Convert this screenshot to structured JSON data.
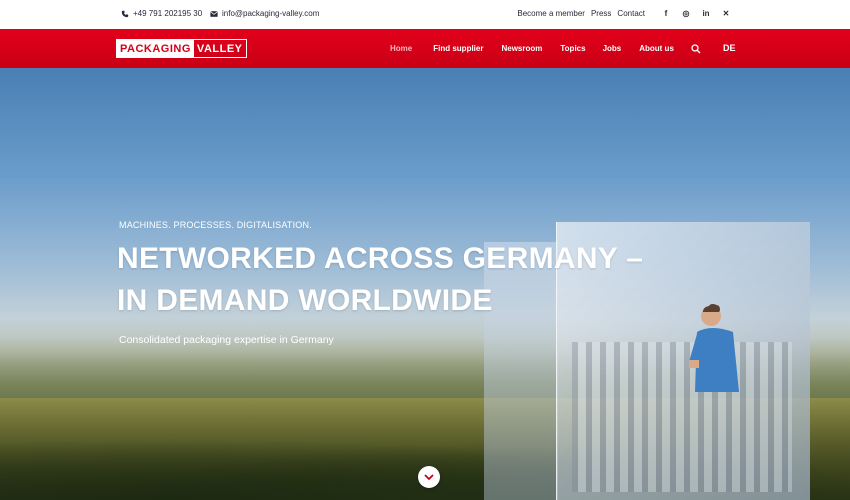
{
  "topbar": {
    "phone": "+49 791 202195 30",
    "email": "info@packaging-valley.com",
    "links": [
      "Become a member",
      "Press",
      "Contact"
    ],
    "social": [
      {
        "name": "facebook-icon",
        "glyph": "f"
      },
      {
        "name": "instagram-icon",
        "glyph": "◎"
      },
      {
        "name": "linkedin-icon",
        "glyph": "in"
      },
      {
        "name": "xing-icon",
        "glyph": "✕"
      }
    ]
  },
  "nav": {
    "logo_part1": "PACKAGING",
    "logo_part2": "VALLEY",
    "items": [
      {
        "label": "Home",
        "active": true
      },
      {
        "label": "Find supplier",
        "active": false
      },
      {
        "label": "Newsroom",
        "active": false
      },
      {
        "label": "Topics",
        "active": false
      },
      {
        "label": "Jobs",
        "active": false
      },
      {
        "label": "About us",
        "active": false
      }
    ],
    "language": "DE"
  },
  "hero": {
    "kicker": "MACHINES. PROCESSES. DIGITALISATION.",
    "headline_line1": "NETWORKED ACROSS GERMANY –",
    "headline_line2": "IN DEMAND WORLDWIDE",
    "subline": "Consolidated packaging expertise in Germany"
  },
  "colors": {
    "brand_red": "#e2001a",
    "active_nav": "#ffb3bb",
    "text_dark": "#2a2a3a"
  }
}
